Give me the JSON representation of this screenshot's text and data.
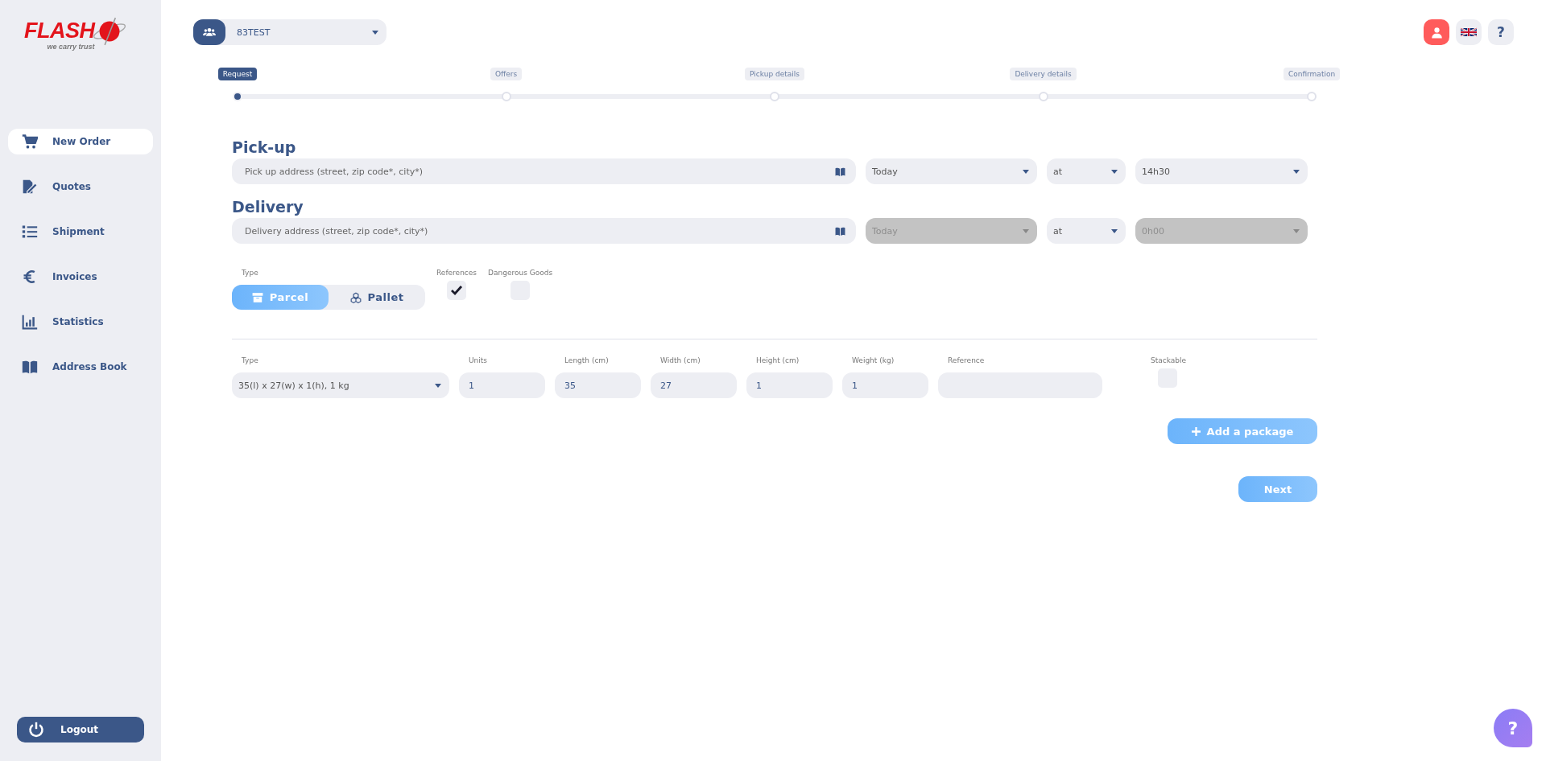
{
  "logo": {
    "name": "FLASH",
    "tagline": "we carry trust"
  },
  "sidebar": {
    "items": [
      {
        "label": "New Order",
        "selected": true
      },
      {
        "label": "Quotes",
        "selected": false
      },
      {
        "label": "Shipment",
        "selected": false
      },
      {
        "label": "Invoices",
        "selected": false
      },
      {
        "label": "Statistics",
        "selected": false
      },
      {
        "label": "Address Book",
        "selected": false
      }
    ],
    "logout": "Logout"
  },
  "account_selector": {
    "value": "83TEST"
  },
  "header_help": "?",
  "stepper": [
    {
      "label": "Request",
      "selected": true
    },
    {
      "label": "Offers",
      "selected": false
    },
    {
      "label": "Pickup details",
      "selected": false
    },
    {
      "label": "Delivery details",
      "selected": false
    },
    {
      "label": "Confirmation",
      "selected": false
    }
  ],
  "sections": [
    {
      "title": "Pick-up",
      "placeholder": "Pick up address (street, zip code*, city*)",
      "date": {
        "value": "Today",
        "disabled": false
      },
      "at": {
        "value": "at",
        "disabled": false
      },
      "time": {
        "value": "14h30",
        "disabled": false
      }
    },
    {
      "title": "Delivery",
      "placeholder": "Delivery address (street, zip code*, city*)",
      "date": {
        "value": "Today",
        "disabled": true
      },
      "at": {
        "value": "at",
        "disabled": false
      },
      "time": {
        "value": "0h00",
        "disabled": true
      }
    }
  ],
  "type": {
    "label": "Type",
    "options": [
      {
        "label": "Parcel",
        "selected": true
      },
      {
        "label": "Pallet",
        "selected": false
      }
    ]
  },
  "options": [
    {
      "label": "References",
      "checked": true
    },
    {
      "label": "Dangerous Goods",
      "checked": false
    }
  ],
  "package": {
    "type_label": "Type",
    "type_value": "35(l) x 27(w) x 1(h), 1 kg",
    "fields": [
      {
        "label": "Units",
        "value": "1"
      },
      {
        "label": "Length (cm)",
        "value": "35"
      },
      {
        "label": "Width (cm)",
        "value": "27"
      },
      {
        "label": "Height (cm)",
        "value": "1"
      },
      {
        "label": "Weight (kg)",
        "value": "1"
      }
    ],
    "reference_label": "Reference",
    "stackable": {
      "label": "Stackable",
      "checked": false
    }
  },
  "add_package": "Add a package",
  "next": "Next",
  "help_bubble": "?"
}
